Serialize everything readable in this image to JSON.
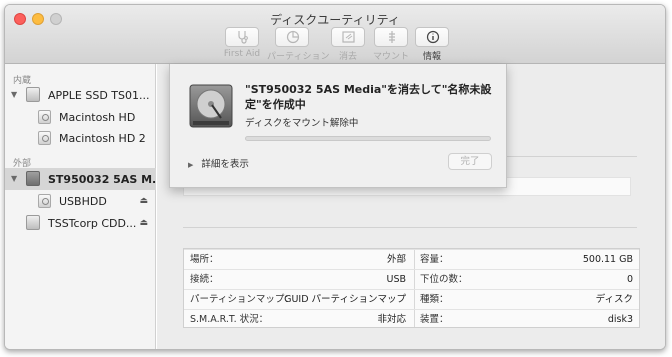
{
  "window": {
    "title": "ディスクユーティリティ"
  },
  "toolbar": {
    "buttons": [
      {
        "label": "First Aid",
        "icon": "stethoscope-icon",
        "enabled": false
      },
      {
        "label": "パーティション",
        "icon": "pie-chart-icon",
        "enabled": false
      },
      {
        "label": "消去",
        "icon": "eraser-icon",
        "enabled": false
      },
      {
        "label": "マウント",
        "icon": "mount-icon",
        "enabled": false
      },
      {
        "label": "情報",
        "icon": "info-icon",
        "enabled": true
      }
    ]
  },
  "sidebar": {
    "internal_header": "内蔵",
    "external_header": "外部",
    "items": [
      {
        "label": "APPLE SSD TS01...",
        "type": "disk",
        "section": "internal",
        "expanded": true
      },
      {
        "label": "Macintosh HD",
        "type": "volume",
        "section": "internal"
      },
      {
        "label": "Macintosh HD 2",
        "type": "volume",
        "section": "internal"
      },
      {
        "label": "ST950032 5AS M...",
        "type": "disk",
        "section": "external",
        "expanded": true,
        "selected": true
      },
      {
        "label": "USBHDD",
        "type": "volume",
        "section": "external",
        "eject": true
      },
      {
        "label": "TSSTcorp CDD...",
        "type": "disk",
        "section": "external",
        "eject": true
      }
    ]
  },
  "sheet": {
    "title": "\"ST950032 5AS Media\"を消去して\"名称未設定\"を作成中",
    "status": "ディスクをマウント解除中",
    "progress": 0,
    "details_label": "詳細を表示",
    "done_label": "完了"
  },
  "info": {
    "rows": [
      {
        "l_label": "場所：",
        "l_value": "外部",
        "r_label": "容量：",
        "r_value": "500.11 GB"
      },
      {
        "l_label": "接続：",
        "l_value": "USB",
        "r_label": "下位の数：",
        "r_value": "0"
      },
      {
        "l_label": "パーティションマップ：",
        "l_value": "GUID パーティションマップ",
        "r_label": "種類：",
        "r_value": "ディスク"
      },
      {
        "l_label": "S.M.A.R.T. 状況：",
        "l_value": "非対応",
        "r_label": "装置：",
        "r_value": "disk3"
      }
    ]
  },
  "colors": {
    "accent": "#5a9df0",
    "close": "#fc605c",
    "minimize": "#fdbc40"
  }
}
